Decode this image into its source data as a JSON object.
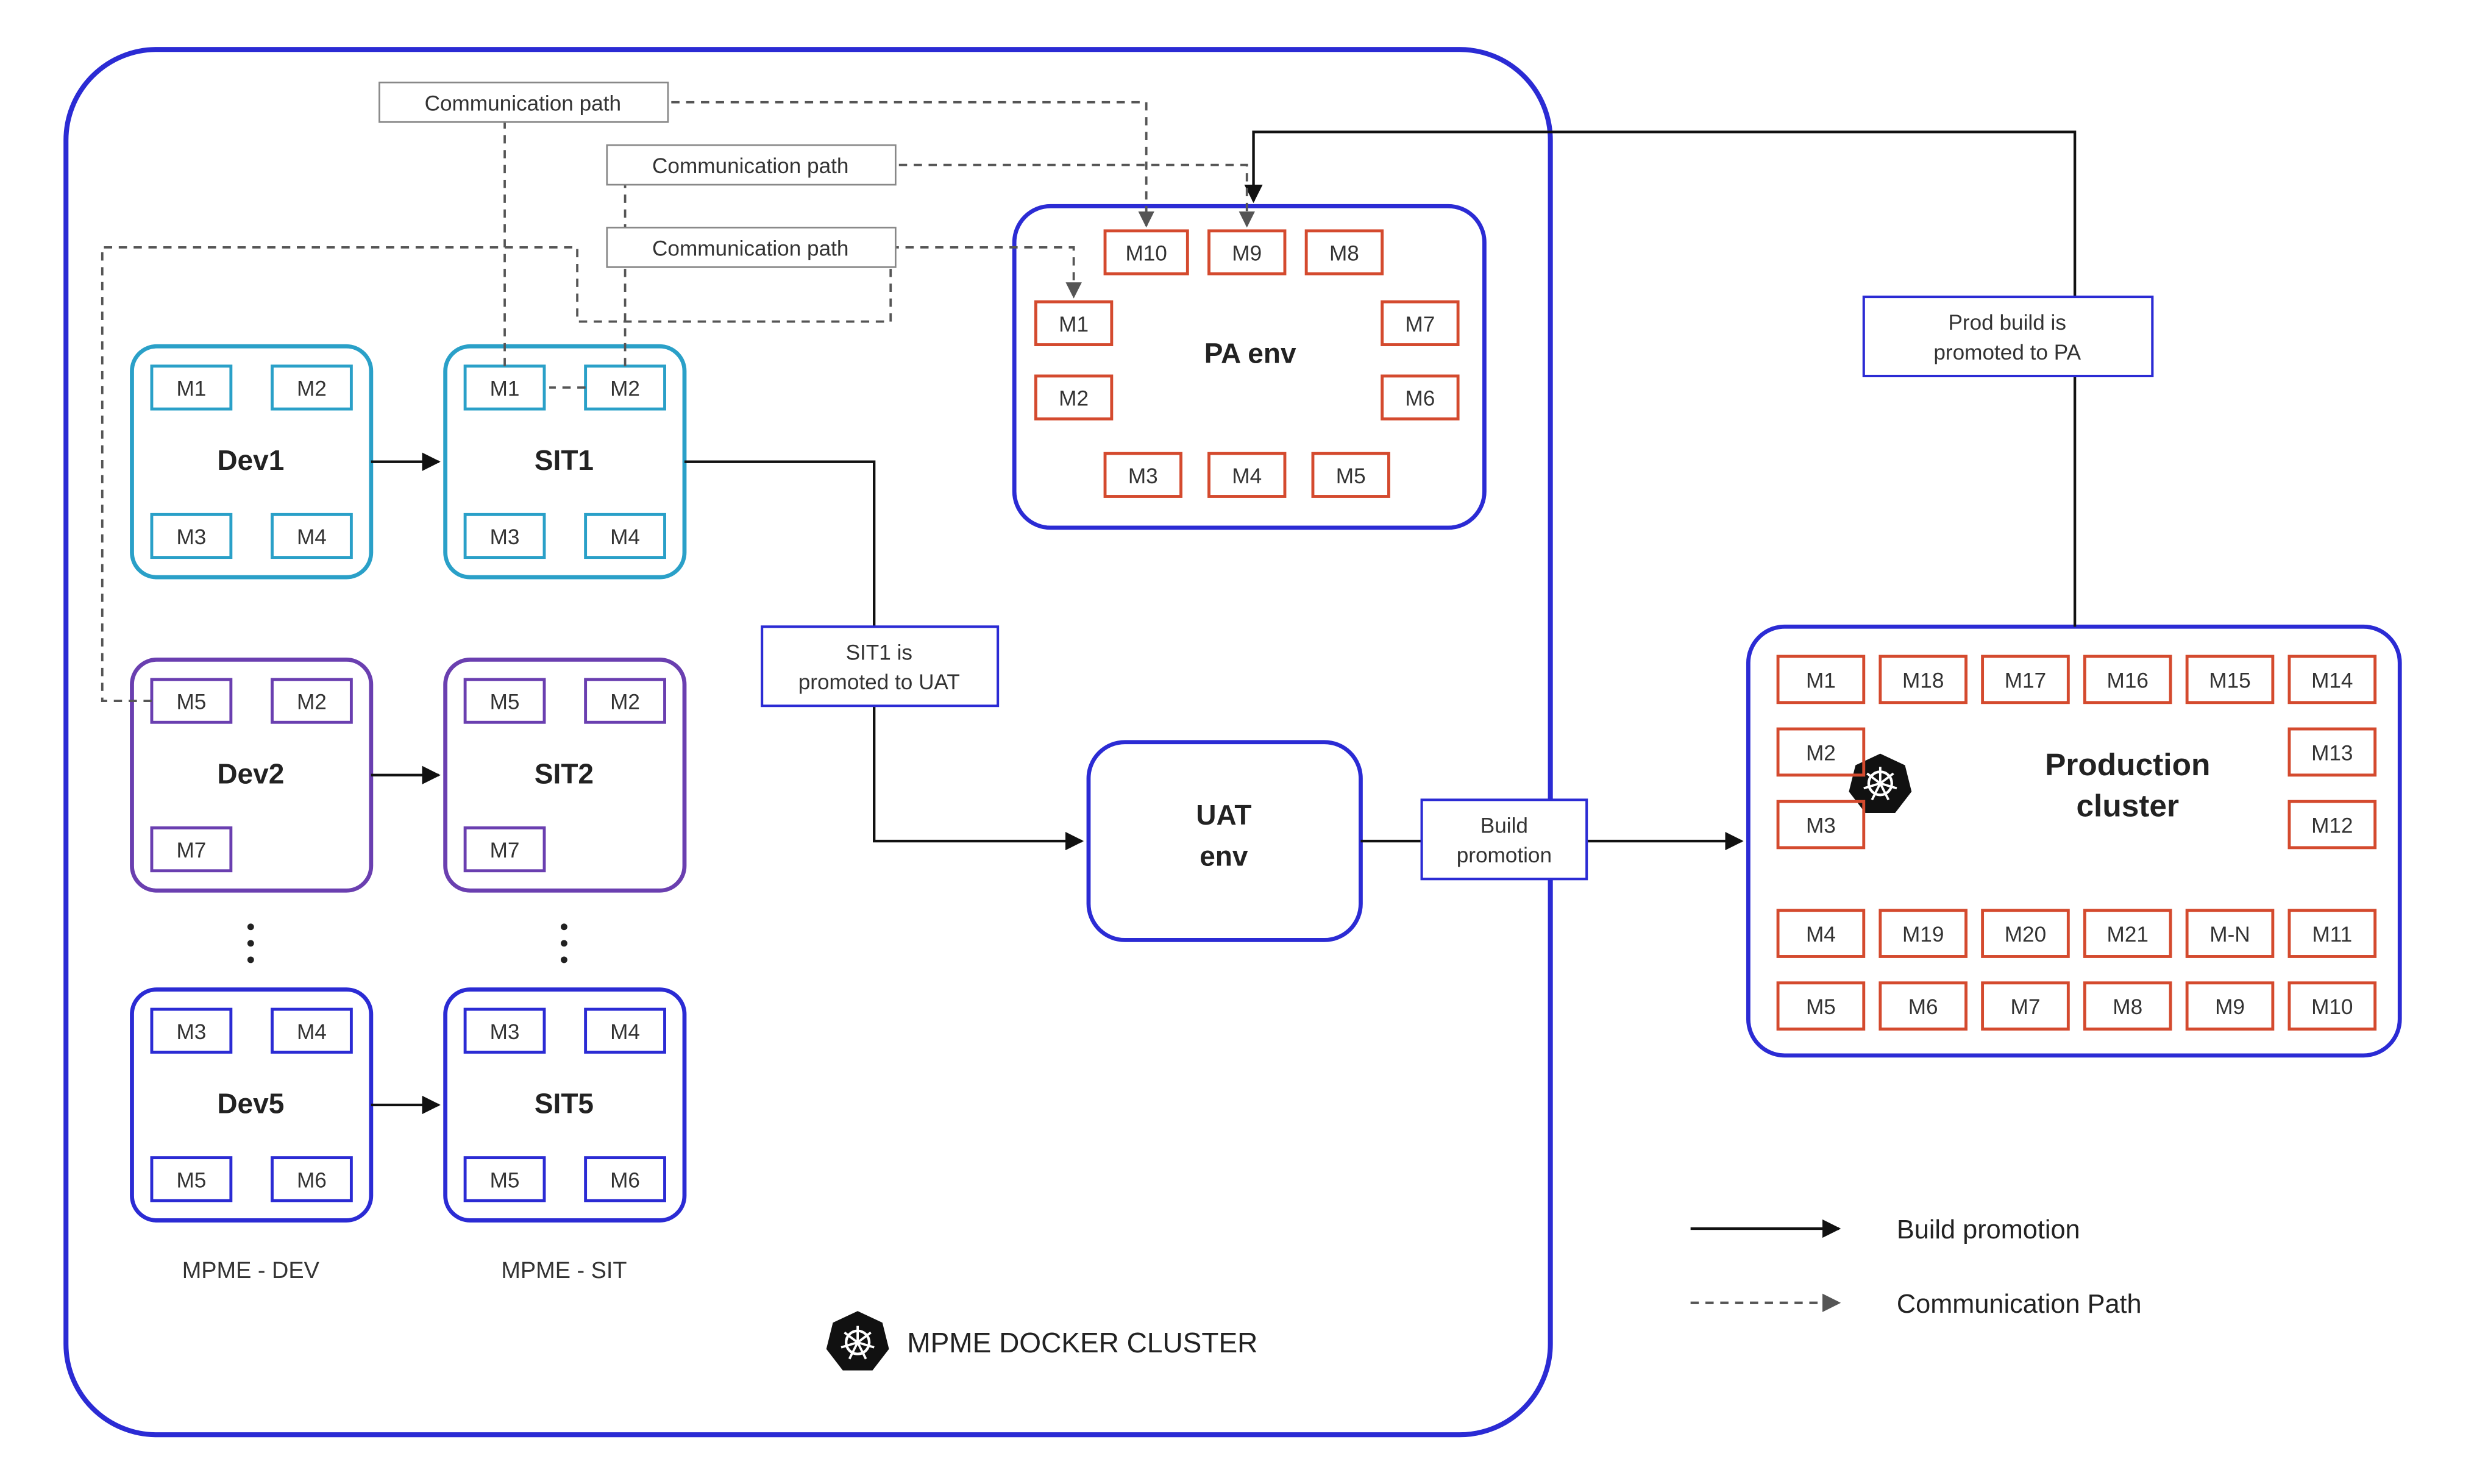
{
  "cluster": {
    "label": "MPME DOCKER CLUSTER"
  },
  "columns": {
    "dev": "MPME - DEV",
    "sit": "MPME - SIT"
  },
  "envs": {
    "dev1": {
      "title": "Dev1",
      "m": [
        "M1",
        "M2",
        "M3",
        "M4"
      ],
      "color": "#2aa0c8"
    },
    "sit1": {
      "title": "SIT1",
      "m": [
        "M1",
        "M2",
        "M3",
        "M4"
      ],
      "color": "#2aa0c8"
    },
    "dev2": {
      "title": "Dev2",
      "m": [
        "M5",
        "M2",
        "M7"
      ],
      "color": "#6a3fb0"
    },
    "sit2": {
      "title": "SIT2",
      "m": [
        "M5",
        "M2",
        "M7"
      ],
      "color": "#6a3fb0"
    },
    "dev5": {
      "title": "Dev5",
      "m": [
        "M3",
        "M4",
        "M5",
        "M6"
      ],
      "color": "#2b2bd4"
    },
    "sit5": {
      "title": "SIT5",
      "m": [
        "M3",
        "M4",
        "M5",
        "M6"
      ],
      "color": "#2b2bd4"
    }
  },
  "pa": {
    "title": "PA env",
    "m": {
      "m1": "M1",
      "m2": "M2",
      "m3": "M3",
      "m4": "M4",
      "m5": "M5",
      "m6": "M6",
      "m7": "M7",
      "m8": "M8",
      "m9": "M9",
      "m10": "M10"
    }
  },
  "uat": {
    "title": "UAT env"
  },
  "prod": {
    "title": "Production cluster",
    "m": [
      "M1",
      "M18",
      "M17",
      "M16",
      "M15",
      "M14",
      "M2",
      "M13",
      "M3",
      "M12",
      "M4",
      "M19",
      "M20",
      "M21",
      "M-N",
      "M11",
      "M5",
      "M6",
      "M7",
      "M8",
      "M9",
      "M10"
    ]
  },
  "labels": {
    "comm": "Communication path",
    "sit_uat": "SIT1 is promoted to UAT",
    "build_promo": "Build promotion",
    "prod_pa": "Prod build is promoted to PA"
  },
  "legend": {
    "build": "Build promotion",
    "comm": "Communication Path"
  }
}
